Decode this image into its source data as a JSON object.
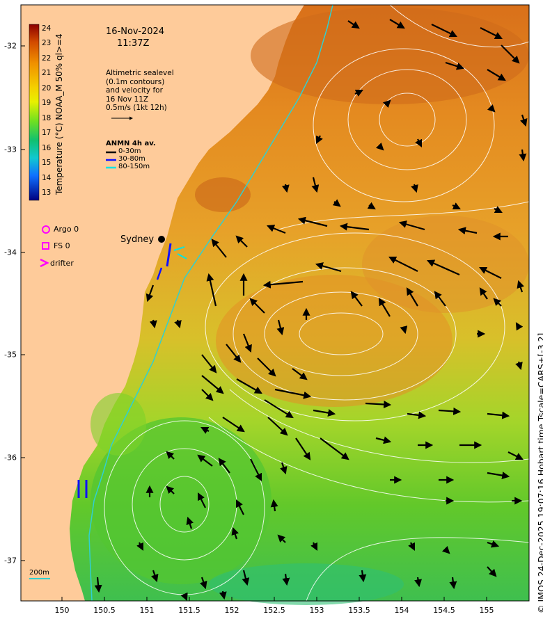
{
  "header": {
    "date": "16-Nov-2024",
    "time": "11:37Z"
  },
  "altimetry": {
    "lines": [
      "Altimetric sealevel",
      "(0.1m contours)",
      "and velocity for",
      "16 Nov 11Z",
      "0.5m/s (1kt 12h)"
    ]
  },
  "anmn": {
    "title": "ANMN 4h av.",
    "items": [
      {
        "label": "0-30m",
        "color": "#000000"
      },
      {
        "label": "30-80m",
        "color": "#1010ff"
      },
      {
        "label": "80-150m",
        "color": "#00e5e5"
      }
    ]
  },
  "legend": {
    "argo": "Argo 0",
    "fs": "FS 0",
    "drifter": "drifter",
    "marker_color": "#ff00ff"
  },
  "place": {
    "sydney": "Sydney"
  },
  "colorbar": {
    "title": "Temperature (°C) NOAA_M 50% ql>=4",
    "ticks": [
      "24",
      "23",
      "22",
      "21",
      "20",
      "19",
      "18",
      "17",
      "16",
      "15",
      "14",
      "13"
    ]
  },
  "axes": {
    "x_ticks": [
      "150",
      "150.5",
      "151",
      "151.5",
      "152",
      "152.5",
      "153",
      "153.5",
      "154",
      "154.5",
      "155"
    ],
    "y_ticks": [
      "-32",
      "-33",
      "-34",
      "-35",
      "-36",
      "-37"
    ]
  },
  "scale": {
    "label": "200m"
  },
  "footer": {
    "copyright": "© IMOS 24-Dec-2025 19:07:16 Hobart time Tscale=CARS+[-3 2]"
  },
  "colors": {
    "land": "#fecb9a",
    "warm": "#e89a20",
    "cool": "#7ed321",
    "isobath": "#30d0d0"
  }
}
